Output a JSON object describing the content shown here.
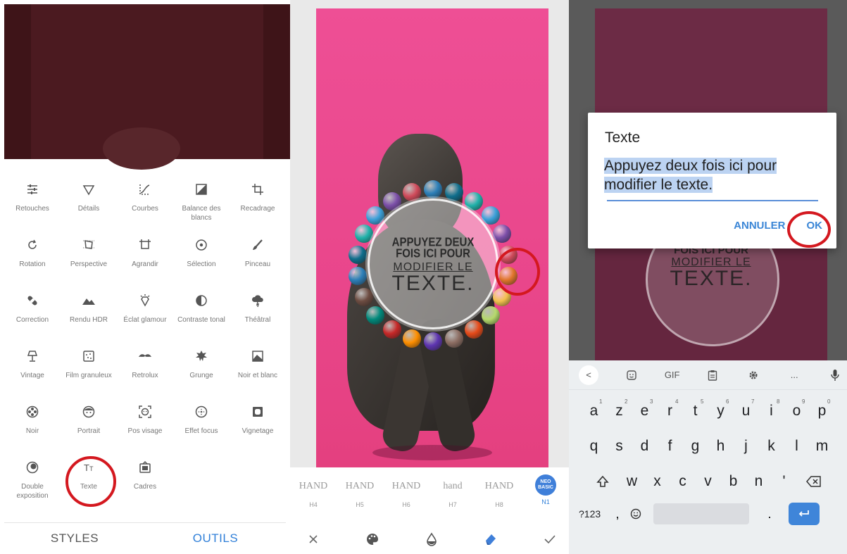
{
  "panel1": {
    "tools": [
      {
        "label": "Retouches",
        "icon": "sliders-icon"
      },
      {
        "label": "Détails",
        "icon": "triangle-down-icon"
      },
      {
        "label": "Courbes",
        "icon": "curves-icon"
      },
      {
        "label": "Balance des blancs",
        "icon": "white-balance-icon"
      },
      {
        "label": "Recadrage",
        "icon": "crop-icon"
      },
      {
        "label": "Rotation",
        "icon": "rotate-icon"
      },
      {
        "label": "Perspective",
        "icon": "perspective-icon"
      },
      {
        "label": "Agrandir",
        "icon": "expand-icon"
      },
      {
        "label": "Sélection",
        "icon": "target-icon"
      },
      {
        "label": "Pinceau",
        "icon": "brush-icon"
      },
      {
        "label": "Correction",
        "icon": "bandage-icon"
      },
      {
        "label": "Rendu HDR",
        "icon": "mountains-icon"
      },
      {
        "label": "Éclat glamour",
        "icon": "diamond-icon"
      },
      {
        "label": "Contraste tonal",
        "icon": "half-circle-icon"
      },
      {
        "label": "Théâtral",
        "icon": "cloud-bolt-icon"
      },
      {
        "label": "Vintage",
        "icon": "lamp-icon"
      },
      {
        "label": "Film granuleux",
        "icon": "film-icon"
      },
      {
        "label": "Retrolux",
        "icon": "mustache-icon"
      },
      {
        "label": "Grunge",
        "icon": "grunge-icon"
      },
      {
        "label": "Noir et blanc",
        "icon": "bw-landscape-icon"
      },
      {
        "label": "Noir",
        "icon": "film-reel-icon"
      },
      {
        "label": "Portrait",
        "icon": "face-icon"
      },
      {
        "label": "Pos visage",
        "icon": "face-frame-icon"
      },
      {
        "label": "Effet focus",
        "icon": "focus-icon"
      },
      {
        "label": "Vignetage",
        "icon": "vignette-icon"
      },
      {
        "label": "Double exposition",
        "icon": "double-circle-icon"
      },
      {
        "label": "Texte",
        "icon": "text-icon"
      },
      {
        "label": "Cadres",
        "icon": "frame-icon"
      }
    ],
    "tabs": {
      "styles": "STYLES",
      "outils": "OUTILS"
    }
  },
  "panel2": {
    "badge": {
      "line1": "APPUYEZ DEUX",
      "line2": "FOIS ICI POUR",
      "line3": "MODIFIER LE",
      "line4": "TEXTE."
    },
    "styles": [
      {
        "thumb": "HAND",
        "name": "H4"
      },
      {
        "thumb": "HAND",
        "name": "H5"
      },
      {
        "thumb": "HAND",
        "name": "H6"
      },
      {
        "thumb": "hand",
        "name": "H7"
      },
      {
        "thumb": "HAND",
        "name": "H8"
      },
      {
        "thumb": "NEO BASIC",
        "name": "N1"
      }
    ]
  },
  "panel3": {
    "badge": {
      "line2": "FOIS ICI POUR",
      "line3": "MODIFIER LE",
      "line4": "TEXTE."
    },
    "dialog": {
      "title": "Texte",
      "value": "Appuyez deux fois ici pour modifier le texte.",
      "cancel": "ANNULER",
      "ok": "OK"
    },
    "keyboard": {
      "toolbar": [
        "<",
        "GIF",
        "..."
      ],
      "row1": [
        {
          "k": "a",
          "h": "1"
        },
        {
          "k": "z",
          "h": "2"
        },
        {
          "k": "e",
          "h": "3"
        },
        {
          "k": "r",
          "h": "4"
        },
        {
          "k": "t",
          "h": "5"
        },
        {
          "k": "y",
          "h": "6"
        },
        {
          "k": "u",
          "h": "7"
        },
        {
          "k": "i",
          "h": "8"
        },
        {
          "k": "o",
          "h": "9"
        },
        {
          "k": "p",
          "h": "0"
        }
      ],
      "row2": [
        "q",
        "s",
        "d",
        "f",
        "g",
        "h",
        "j",
        "k",
        "l",
        "m"
      ],
      "row3": [
        "w",
        "x",
        "c",
        "v",
        "b",
        "n",
        "'"
      ],
      "symbols": "?123",
      "comma": ",",
      "dot": "."
    }
  },
  "colors": {
    "accent": "#2f7fd8",
    "annotation": "#d4181f",
    "photo_pink": "#ee4f95"
  }
}
